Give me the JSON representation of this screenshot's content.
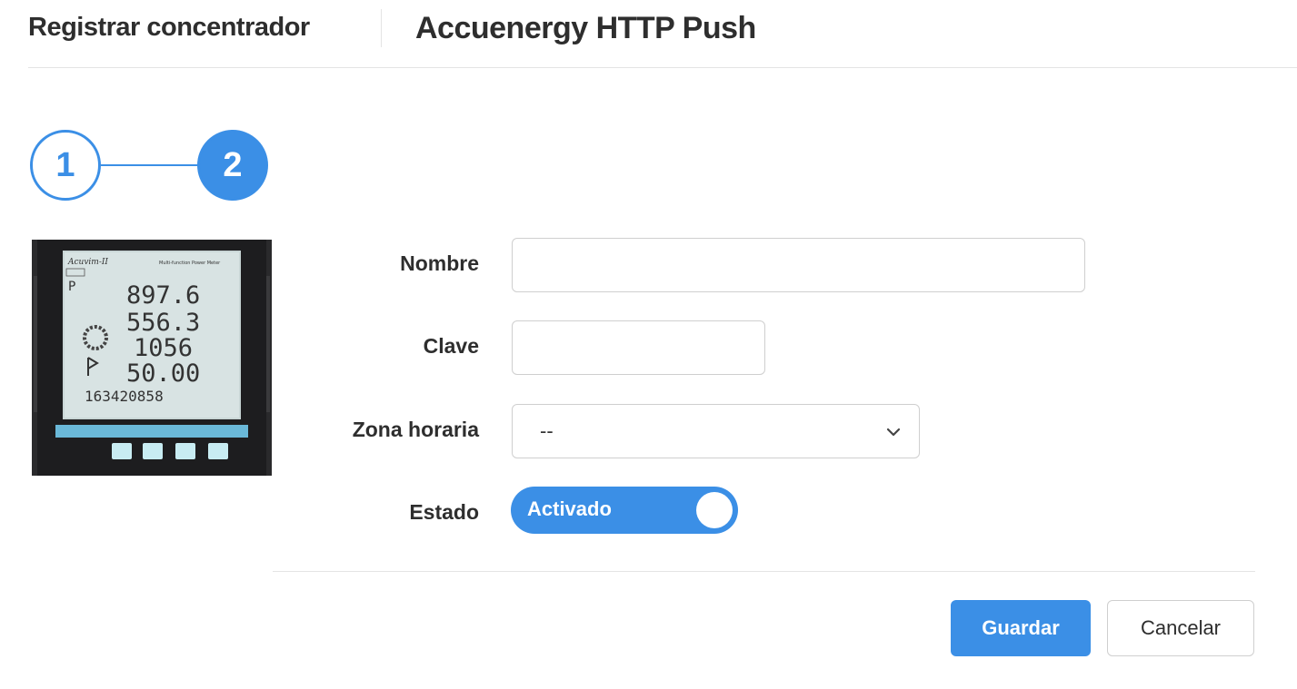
{
  "header": {
    "breadcrumb": "Registrar concentrador",
    "title": "Accuenergy HTTP Push"
  },
  "stepper": {
    "steps": [
      "1",
      "2"
    ],
    "current": 2
  },
  "device_image": {
    "icon": "power-meter-device",
    "brand_text": "Acuvim-II",
    "subtitle_text": "Multi-function Power Meter",
    "readings": [
      "897.6",
      "556.3",
      "1056",
      "50.00",
      "163420858"
    ]
  },
  "form": {
    "nombre": {
      "label": "Nombre",
      "value": "",
      "placeholder": ""
    },
    "clave": {
      "label": "Clave",
      "value": "",
      "placeholder": ""
    },
    "zona_horaria": {
      "label": "Zona horaria",
      "value": "--"
    },
    "estado": {
      "label": "Estado",
      "value": "Activado",
      "on": true
    }
  },
  "actions": {
    "save": "Guardar",
    "cancel": "Cancelar"
  },
  "colors": {
    "accent": "#3b8fe6",
    "text": "#2e2e2e",
    "border": "#cfcfcf"
  }
}
